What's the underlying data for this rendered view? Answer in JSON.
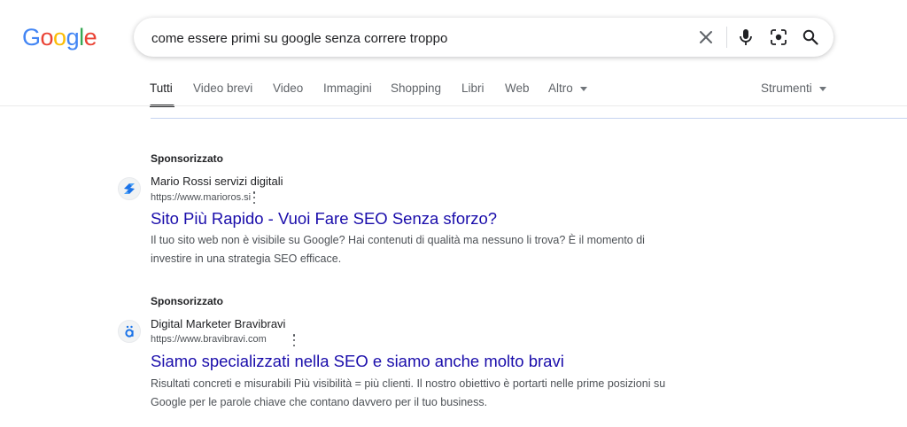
{
  "logo": {
    "letters": [
      "G",
      "o",
      "o",
      "g",
      "l",
      "e"
    ],
    "colors": [
      "#4285f4",
      "#ea4335",
      "#fbbc05",
      "#4285f4",
      "#34a853",
      "#ea4335"
    ]
  },
  "search": {
    "query": "come essere primi su google senza correre troppo"
  },
  "tabs": [
    {
      "label": "Tutti",
      "active": true
    },
    {
      "label": "Video brevi"
    },
    {
      "label": "Video"
    },
    {
      "label": "Immagini"
    },
    {
      "label": "Shopping"
    },
    {
      "label": "Libri"
    },
    {
      "label": "Web"
    },
    {
      "label": "Altro"
    }
  ],
  "tools": {
    "label": "Strumenti"
  },
  "ads": [
    {
      "sponsored": "Sponsorizzato",
      "site_name": "Mario Rossi servizi digitali",
      "url": "https://www.marioros.si",
      "title": "Sito Più Rapido - Vuoi Fare SEO Senza sforzo?",
      "desc_lines": [
        "Il tuo sito web non è visibile su Google? Hai contenuti di qualità ma nessuno li trova? È il momento di",
        "investire in una strategia SEO efficace."
      ],
      "favicon": "blue-arrows-icon"
    },
    {
      "sponsored": "Sponsorizzato",
      "site_name": "Digital Marketer Bravibravi",
      "url": "https://www.bravibravi.com",
      "title": "Siamo specializzati nella SEO e siamo anche molto bravi",
      "desc_lines": [
        "Risultati concreti e misurabili Più visibilità = più clienti. Il nostro obiettivo è portarti nelle prime posizioni su",
        "Google per le parole chiave che contano davvero per il tuo business."
      ],
      "favicon": "a-umlaut-icon"
    }
  ],
  "colors": {
    "link": "#1a0dab",
    "accent": "#4285f4"
  }
}
